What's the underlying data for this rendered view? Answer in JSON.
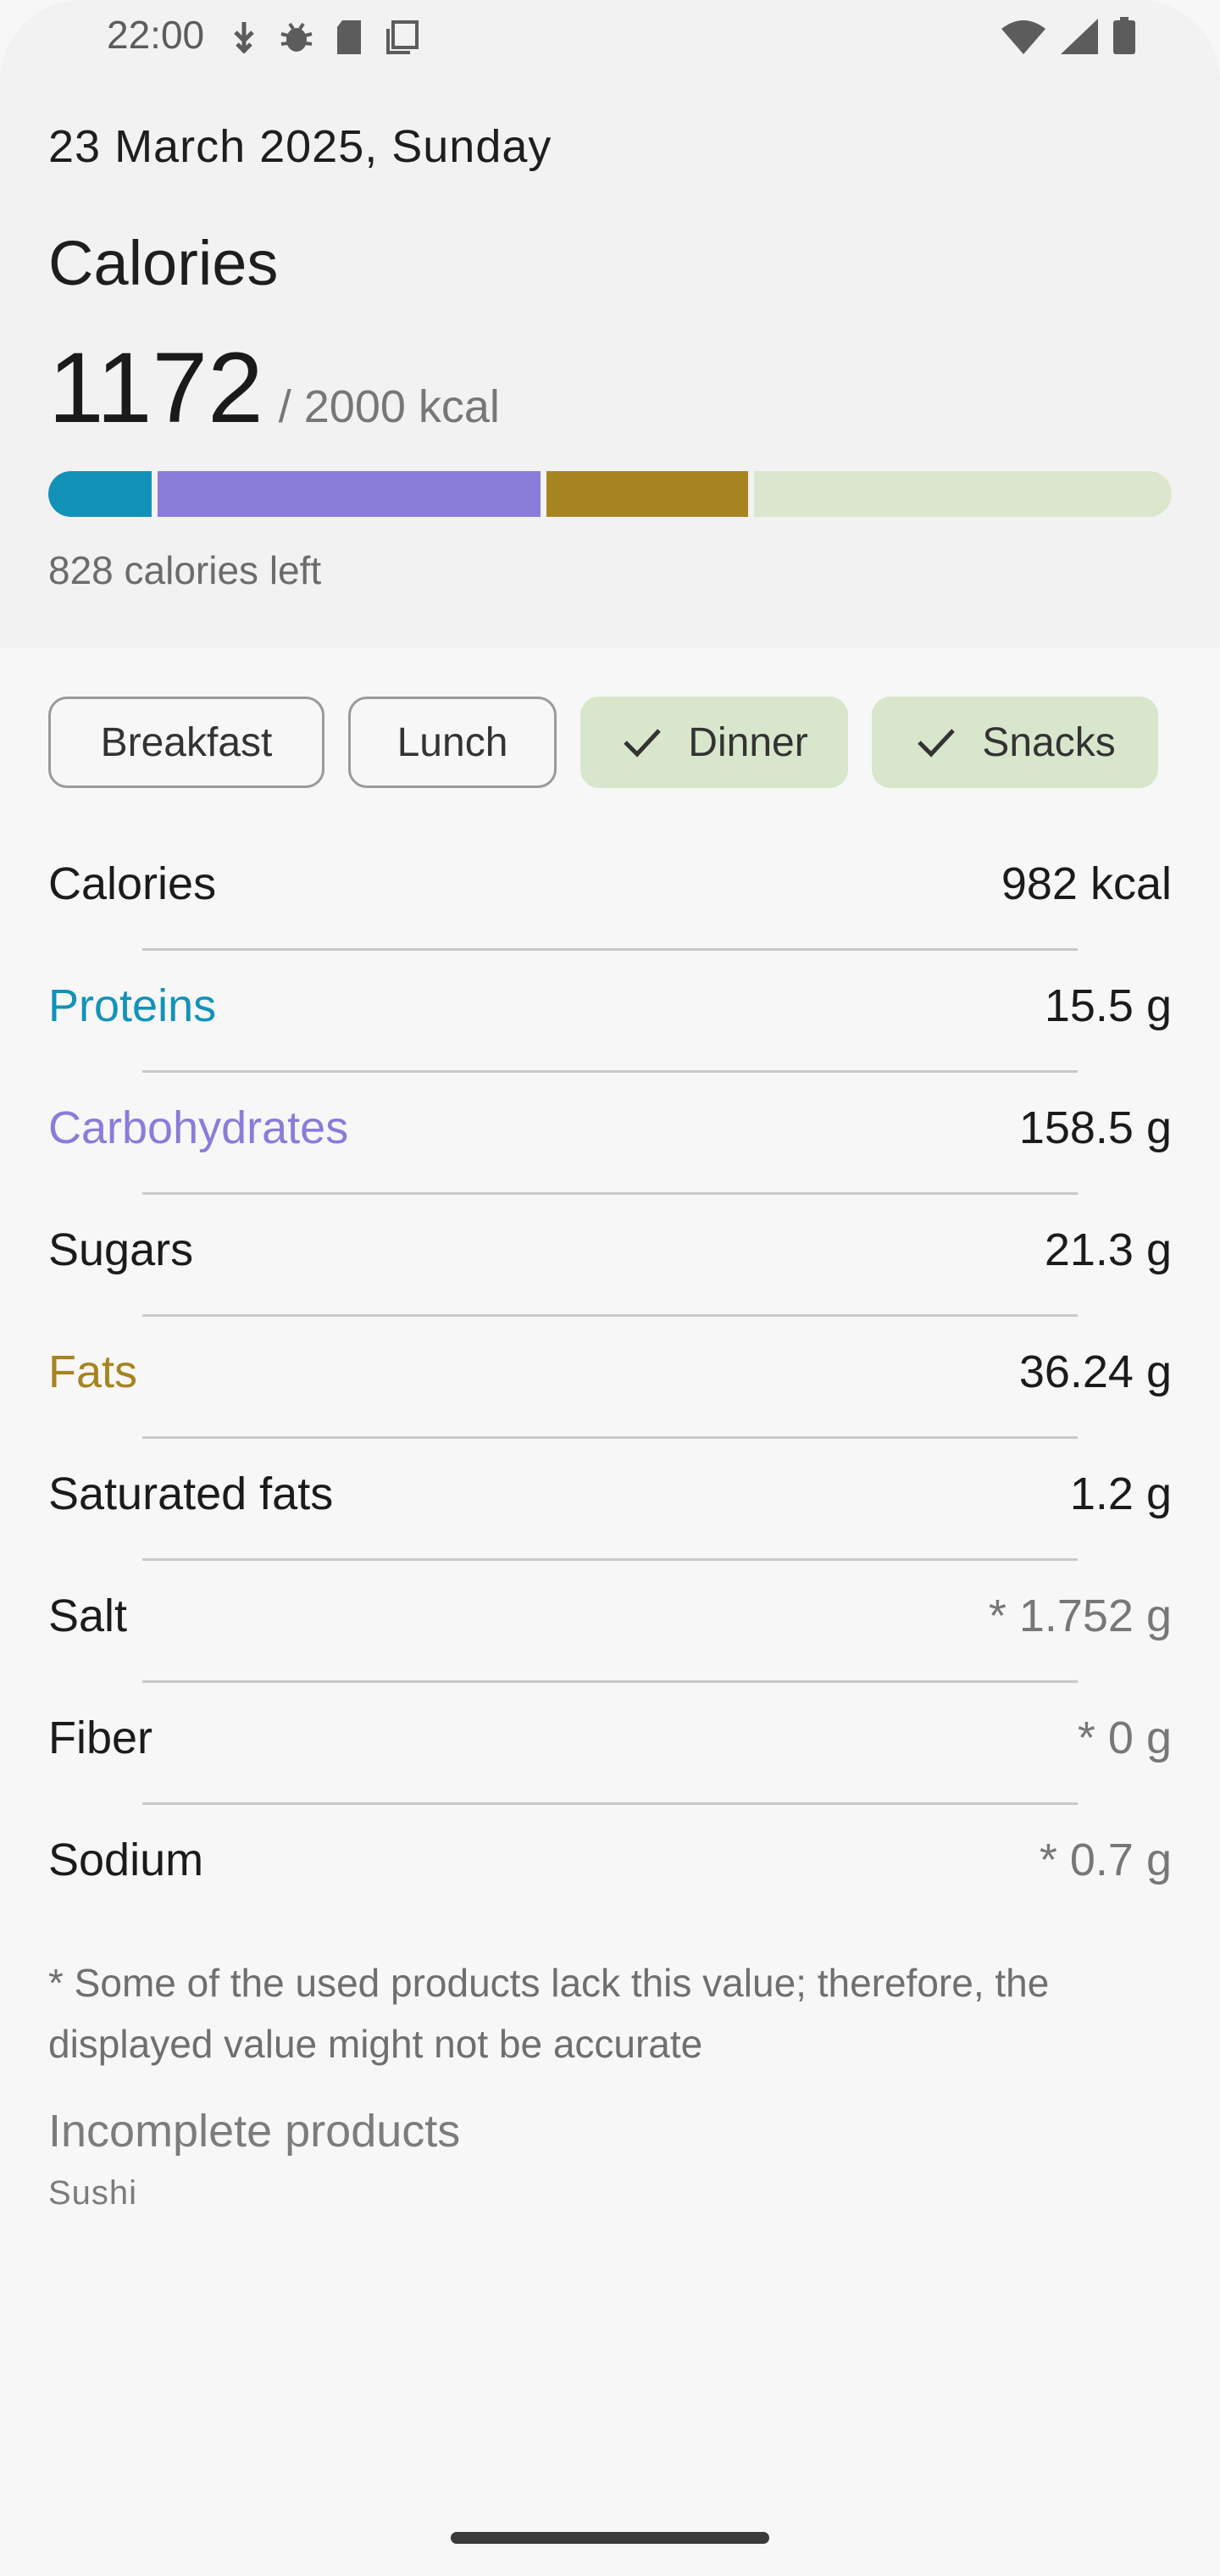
{
  "status": {
    "time": "22:00",
    "left_icons": [
      "usb-debug-icon",
      "bug-icon",
      "sd-card-icon",
      "copy-icon"
    ],
    "right_icons": [
      "wifi-icon",
      "signal-icon",
      "battery-icon"
    ]
  },
  "header": {
    "date": "23 March 2025, Sunday",
    "title": "Calories",
    "consumed": "1172",
    "goal": "/ 2000 kcal",
    "left": "828 calories left",
    "progress": {
      "proteins_fraction": 0.061,
      "carbohydrates_fraction": 0.228,
      "fats_fraction": 0.12
    }
  },
  "chips": [
    {
      "label": "Breakfast",
      "selected": false
    },
    {
      "label": "Lunch",
      "selected": false
    },
    {
      "label": "Dinner",
      "selected": true
    },
    {
      "label": "Snacks",
      "selected": true
    }
  ],
  "nutrients": [
    {
      "name": "Calories",
      "value": "982 kcal"
    },
    {
      "name": "Proteins",
      "value": "15.5 g"
    },
    {
      "name": "Carbohydrates",
      "value": "158.5 g"
    },
    {
      "name": "Sugars",
      "value": "21.3 g"
    },
    {
      "name": "Fats",
      "value": "36.24 g"
    },
    {
      "name": "Saturated fats",
      "value": "1.2 g"
    },
    {
      "name": "Salt",
      "value": "* 1.752 g"
    },
    {
      "name": "Fiber",
      "value": "* 0 g"
    },
    {
      "name": "Sodium",
      "value": "* 0.7 g"
    }
  ],
  "note": "* Some of the used products lack this value; therefore, the displayed value might not be accurate",
  "incomplete": {
    "title": "Incomplete products",
    "items": [
      "Sushi"
    ]
  },
  "colors": {
    "proteins": "#1392b8",
    "carbohydrates": "#8a7cd9",
    "fats": "#a68421",
    "remaining": "#dbe6cd",
    "chip_selected": "#d8e6cc"
  }
}
